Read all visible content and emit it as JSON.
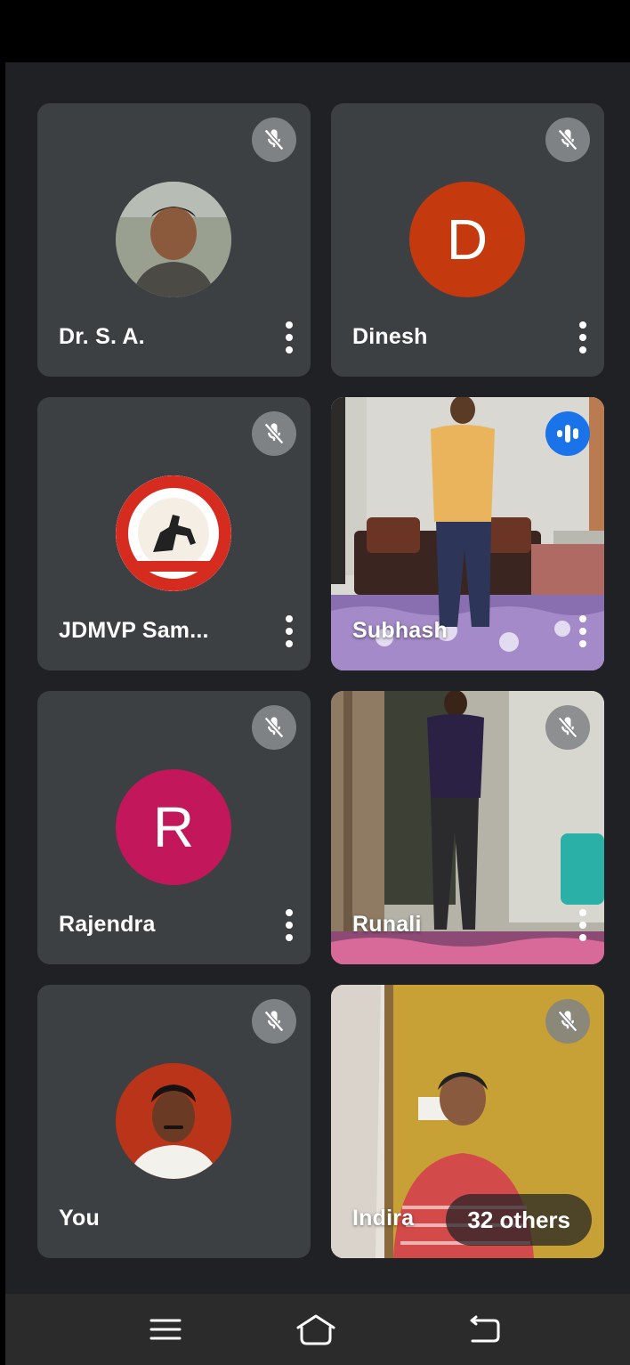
{
  "participants": [
    {
      "name": "Dr. S. A.",
      "type": "photo-avatar",
      "muted": true
    },
    {
      "name": "Dinesh",
      "type": "initial-avatar",
      "initial": "D",
      "color": "#c5390f",
      "muted": true
    },
    {
      "name": "JDMVP Sam...",
      "type": "logo-avatar",
      "muted": true
    },
    {
      "name": "Subhash",
      "type": "video",
      "speaking": true
    },
    {
      "name": "Rajendra",
      "type": "initial-avatar",
      "initial": "R",
      "color": "#c2185b",
      "muted": true
    },
    {
      "name": "Runali",
      "type": "video",
      "muted": true
    },
    {
      "name": "You",
      "type": "photo-avatar",
      "muted": true
    },
    {
      "name": "Indira",
      "type": "video",
      "muted": true
    }
  ],
  "others_label": "32 others",
  "icons": {
    "muted": "mic-off-icon",
    "speaking": "audio-bars-icon",
    "more": "more-vertical-icon"
  },
  "nav": [
    "menu-icon",
    "home-icon",
    "back-icon"
  ],
  "colors": {
    "background": "#202124",
    "tile": "#3c4043",
    "speaking": "#1a73e8"
  }
}
